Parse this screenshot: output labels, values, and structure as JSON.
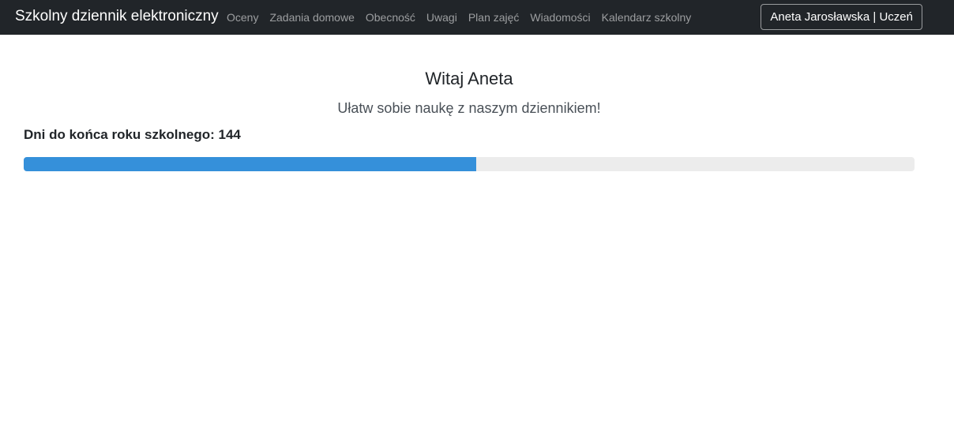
{
  "navbar": {
    "brand": "Szkolny dziennik elektroniczny",
    "links": [
      "Oceny",
      "Zadania domowe",
      "Obecność",
      "Uwagi",
      "Plan zajęć",
      "Wiadomości",
      "Kalendarz szkolny"
    ],
    "user_button": "Aneta Jarosławska | Uczeń"
  },
  "main": {
    "welcome": "Witaj Aneta",
    "subtitle": "Ułatw sobie naukę z naszym dziennikiem!",
    "days_left_label": "Dni do końca roku szkolnego: 144",
    "progress_percent": 50.8
  },
  "colors": {
    "navbar_bg": "#212529",
    "progress_fill": "#3590da",
    "progress_track": "#ececec"
  }
}
